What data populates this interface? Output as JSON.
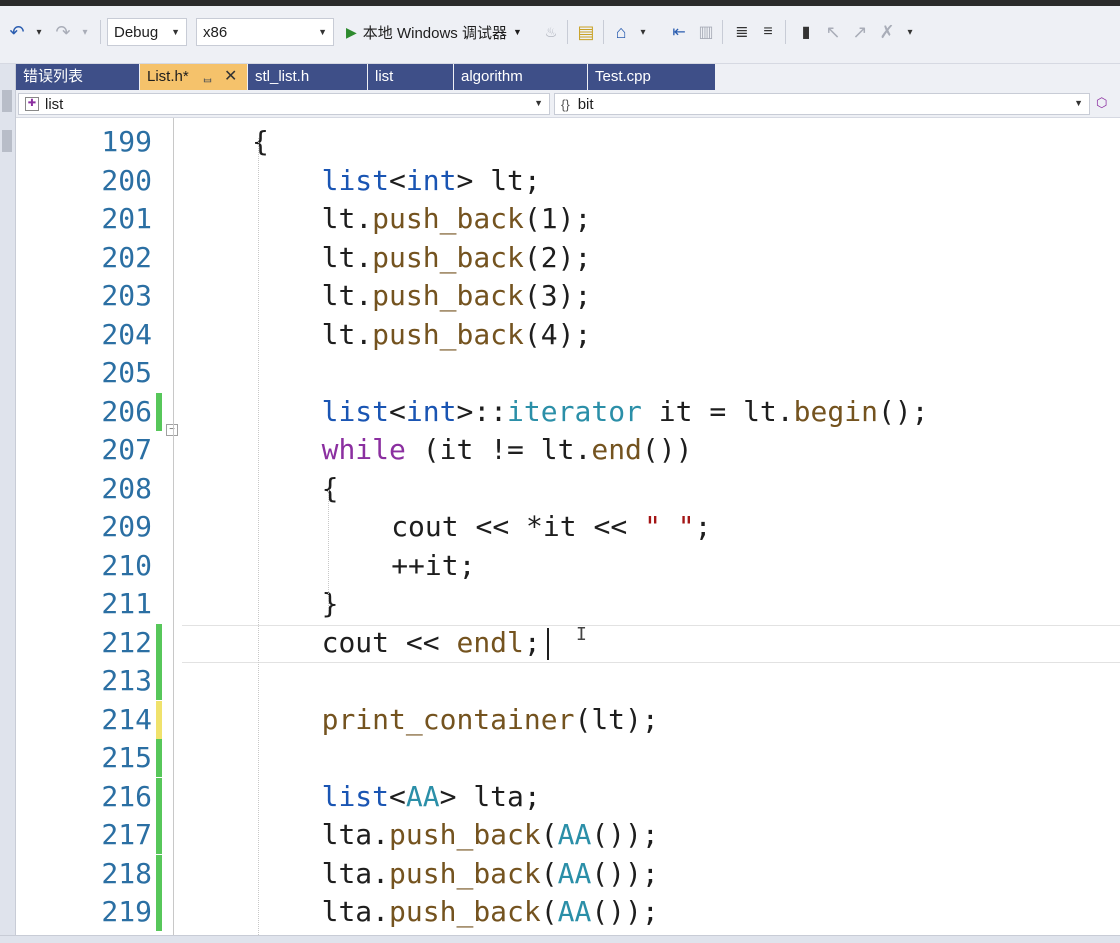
{
  "toolbar": {
    "config_value": "Debug",
    "platform_value": "x86",
    "run_label": "本地 Windows 调试器"
  },
  "tabs": [
    {
      "label": "错误列表",
      "active": false
    },
    {
      "label": "List.h*",
      "active": true
    },
    {
      "label": "stl_list.h",
      "active": false
    },
    {
      "label": "list",
      "active": false
    },
    {
      "label": "algorithm",
      "active": false
    },
    {
      "label": "Test.cpp",
      "active": false
    }
  ],
  "nav": {
    "scope_value": "list",
    "member_value": "bit"
  },
  "editor": {
    "lines": [
      {
        "num": "199",
        "change": "none",
        "indent": 2,
        "tokens": [
          [
            "op",
            "{"
          ]
        ]
      },
      {
        "num": "200",
        "change": "none",
        "indent": 4,
        "tokens": [
          [
            "kw",
            "list"
          ],
          [
            "op",
            "<"
          ],
          [
            "kw",
            "int"
          ],
          [
            "op",
            "> "
          ],
          [
            "id",
            "lt"
          ],
          [
            "op",
            ";"
          ]
        ]
      },
      {
        "num": "201",
        "change": "none",
        "indent": 4,
        "tokens": [
          [
            "id",
            "lt"
          ],
          [
            "op",
            "."
          ],
          [
            "fn",
            "push_back"
          ],
          [
            "op",
            "("
          ],
          [
            "num",
            "1"
          ],
          [
            "op",
            ");"
          ]
        ]
      },
      {
        "num": "202",
        "change": "none",
        "indent": 4,
        "tokens": [
          [
            "id",
            "lt"
          ],
          [
            "op",
            "."
          ],
          [
            "fn",
            "push_back"
          ],
          [
            "op",
            "("
          ],
          [
            "num",
            "2"
          ],
          [
            "op",
            ");"
          ]
        ]
      },
      {
        "num": "203",
        "change": "none",
        "indent": 4,
        "tokens": [
          [
            "id",
            "lt"
          ],
          [
            "op",
            "."
          ],
          [
            "fn",
            "push_back"
          ],
          [
            "op",
            "("
          ],
          [
            "num",
            "3"
          ],
          [
            "op",
            ");"
          ]
        ]
      },
      {
        "num": "204",
        "change": "none",
        "indent": 4,
        "tokens": [
          [
            "id",
            "lt"
          ],
          [
            "op",
            "."
          ],
          [
            "fn",
            "push_back"
          ],
          [
            "op",
            "("
          ],
          [
            "num",
            "4"
          ],
          [
            "op",
            ");"
          ]
        ]
      },
      {
        "num": "205",
        "change": "none",
        "indent": 4,
        "tokens": []
      },
      {
        "num": "206",
        "change": "green",
        "indent": 4,
        "tokens": [
          [
            "kw",
            "list"
          ],
          [
            "op",
            "<"
          ],
          [
            "kw",
            "int"
          ],
          [
            "op",
            ">::"
          ],
          [
            "ty",
            "iterator"
          ],
          [
            "op",
            " "
          ],
          [
            "id",
            "it"
          ],
          [
            "op",
            " = "
          ],
          [
            "id",
            "lt"
          ],
          [
            "op",
            "."
          ],
          [
            "fn",
            "begin"
          ],
          [
            "op",
            "();"
          ]
        ]
      },
      {
        "num": "207",
        "change": "none",
        "indent": 4,
        "tokens": [
          [
            "kw2",
            "while"
          ],
          [
            "op",
            " ("
          ],
          [
            "id",
            "it"
          ],
          [
            "op",
            " != "
          ],
          [
            "id",
            "lt"
          ],
          [
            "op",
            "."
          ],
          [
            "fn",
            "end"
          ],
          [
            "op",
            "())"
          ]
        ]
      },
      {
        "num": "208",
        "change": "none",
        "indent": 4,
        "tokens": [
          [
            "op",
            "{"
          ]
        ]
      },
      {
        "num": "209",
        "change": "none",
        "indent": 6,
        "tokens": [
          [
            "id",
            "cout"
          ],
          [
            "op",
            " << *"
          ],
          [
            "id",
            "it"
          ],
          [
            "op",
            " << "
          ],
          [
            "str",
            "\" \""
          ],
          [
            "op",
            ";"
          ]
        ]
      },
      {
        "num": "210",
        "change": "none",
        "indent": 6,
        "tokens": [
          [
            "op",
            "++"
          ],
          [
            "id",
            "it"
          ],
          [
            "op",
            ";"
          ]
        ]
      },
      {
        "num": "211",
        "change": "none",
        "indent": 4,
        "tokens": [
          [
            "op",
            "}"
          ]
        ]
      },
      {
        "num": "212",
        "change": "green",
        "indent": 4,
        "tokens": [
          [
            "id",
            "cout"
          ],
          [
            "op",
            " << "
          ],
          [
            "fn",
            "endl"
          ],
          [
            "op",
            ";"
          ]
        ]
      },
      {
        "num": "213",
        "change": "green",
        "indent": 4,
        "tokens": []
      },
      {
        "num": "214",
        "change": "yellow",
        "indent": 4,
        "tokens": [
          [
            "fn",
            "print_container"
          ],
          [
            "op",
            "("
          ],
          [
            "id",
            "lt"
          ],
          [
            "op",
            ");"
          ]
        ]
      },
      {
        "num": "215",
        "change": "green",
        "indent": 4,
        "tokens": []
      },
      {
        "num": "216",
        "change": "green",
        "indent": 4,
        "tokens": [
          [
            "kw",
            "list"
          ],
          [
            "op",
            "<"
          ],
          [
            "ty",
            "AA"
          ],
          [
            "op",
            "> "
          ],
          [
            "id",
            "lta"
          ],
          [
            "op",
            ";"
          ]
        ]
      },
      {
        "num": "217",
        "change": "green",
        "indent": 4,
        "tokens": [
          [
            "id",
            "lta"
          ],
          [
            "op",
            "."
          ],
          [
            "fn",
            "push_back"
          ],
          [
            "op",
            "("
          ],
          [
            "ty",
            "AA"
          ],
          [
            "op",
            "());"
          ]
        ]
      },
      {
        "num": "218",
        "change": "green",
        "indent": 4,
        "tokens": [
          [
            "id",
            "lta"
          ],
          [
            "op",
            "."
          ],
          [
            "fn",
            "push_back"
          ],
          [
            "op",
            "("
          ],
          [
            "ty",
            "AA"
          ],
          [
            "op",
            "());"
          ]
        ]
      },
      {
        "num": "219",
        "change": "green",
        "indent": 4,
        "tokens": [
          [
            "id",
            "lta"
          ],
          [
            "op",
            "."
          ],
          [
            "fn",
            "push_back"
          ],
          [
            "op",
            "("
          ],
          [
            "ty",
            "AA"
          ],
          [
            "op",
            "());"
          ]
        ]
      }
    ]
  }
}
